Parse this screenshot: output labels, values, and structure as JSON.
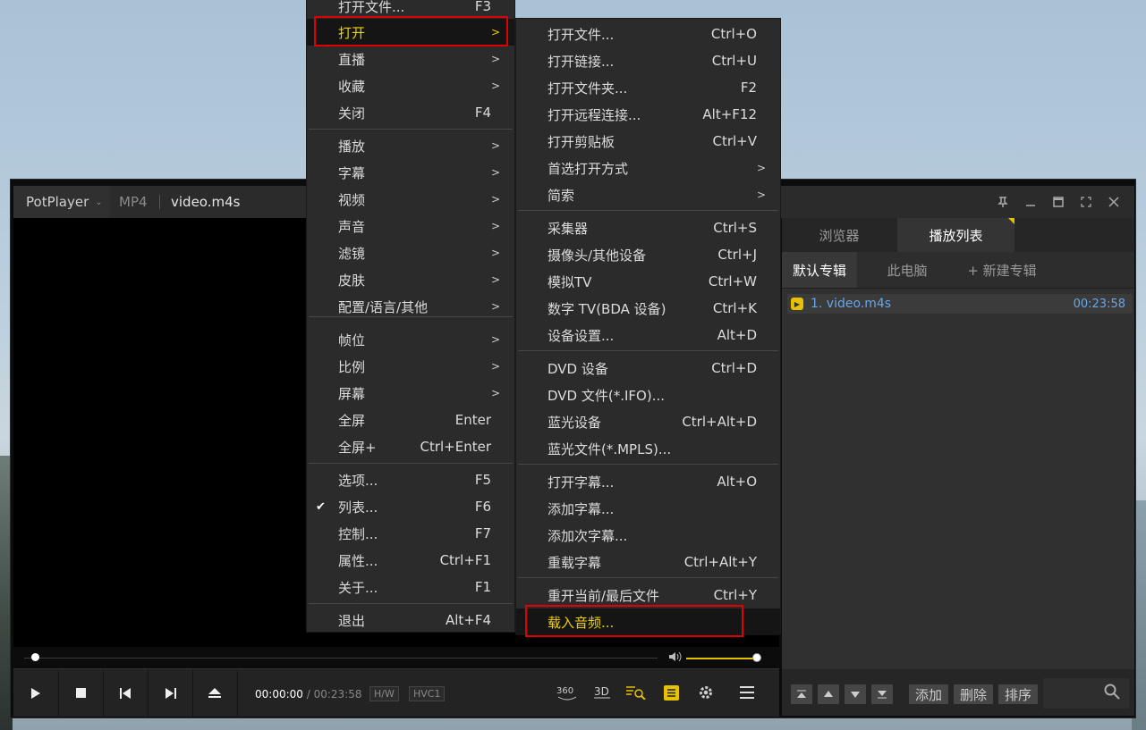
{
  "player": {
    "brand": "PotPlayer",
    "format": "MP4",
    "filename": "video.m4s",
    "time_current": "00:00:00",
    "time_separator": "/",
    "time_total": "00:23:58",
    "tag_hw": "H/W",
    "tag_codec": "HVC1",
    "seek_progress": 0,
    "volume_level": 0.95
  },
  "panel": {
    "tabs": [
      "浏览器",
      "播放列表"
    ],
    "active_tab": "播放列表",
    "subtabs": [
      "默认专辑",
      "此电脑",
      "+ 新建专辑"
    ],
    "playlist": [
      {
        "title": "1. video.m4s",
        "duration": "00:23:58"
      }
    ],
    "footer_buttons": [
      "添加",
      "删除",
      "排序"
    ]
  },
  "main_menu": {
    "items": [
      {
        "label": "打开文件...",
        "shortcut": "F3"
      },
      {
        "label": "打开",
        "submenu": ">",
        "highlighted": true
      },
      {
        "label": "直播",
        "submenu": ">"
      },
      {
        "label": "收藏",
        "submenu": ">"
      },
      {
        "label": "关闭",
        "shortcut": "F4"
      },
      {
        "label": "播放",
        "submenu": ">"
      },
      {
        "label": "字幕",
        "submenu": ">"
      },
      {
        "label": "视频",
        "submenu": ">"
      },
      {
        "label": "声音",
        "submenu": ">"
      },
      {
        "label": "滤镜",
        "submenu": ">"
      },
      {
        "label": "皮肤",
        "submenu": ">"
      },
      {
        "label": "配置/语言/其他",
        "submenu": ">"
      },
      {
        "label": "帧位",
        "submenu": ">"
      },
      {
        "label": "比例",
        "submenu": ">"
      },
      {
        "label": "屏幕",
        "submenu": ">"
      },
      {
        "label": "全屏",
        "shortcut": "Enter"
      },
      {
        "label": "全屏+",
        "shortcut": "Ctrl+Enter"
      },
      {
        "label": "选项...",
        "shortcut": "F5"
      },
      {
        "label": "列表...",
        "shortcut": "F6",
        "checked": true
      },
      {
        "label": "控制...",
        "shortcut": "F7"
      },
      {
        "label": "属性...",
        "shortcut": "Ctrl+F1"
      },
      {
        "label": "关于...",
        "shortcut": "F1"
      },
      {
        "label": "退出",
        "shortcut": "Alt+F4"
      }
    ]
  },
  "open_submenu": {
    "items": [
      {
        "label": "打开文件...",
        "shortcut": "Ctrl+O"
      },
      {
        "label": "打开链接...",
        "shortcut": "Ctrl+U"
      },
      {
        "label": "打开文件夹...",
        "shortcut": "F2"
      },
      {
        "label": "打开远程连接...",
        "shortcut": "Alt+F12"
      },
      {
        "label": "打开剪贴板",
        "shortcut": "Ctrl+V"
      },
      {
        "label": "首选打开方式",
        "submenu": ">"
      },
      {
        "label": "简索",
        "submenu": ">"
      },
      {
        "label": "采集器",
        "shortcut": "Ctrl+S"
      },
      {
        "label": "摄像头/其他设备",
        "shortcut": "Ctrl+J"
      },
      {
        "label": "模拟TV",
        "shortcut": "Ctrl+W"
      },
      {
        "label": "数字 TV(BDA 设备)",
        "shortcut": "Ctrl+K"
      },
      {
        "label": "设备设置...",
        "shortcut": "Alt+D"
      },
      {
        "label": "DVD 设备",
        "shortcut": "Ctrl+D"
      },
      {
        "label": "DVD 文件(*.IFO)..."
      },
      {
        "label": "蓝光设备",
        "shortcut": "Ctrl+Alt+D"
      },
      {
        "label": "蓝光文件(*.MPLS)..."
      },
      {
        "label": "打开字幕...",
        "shortcut": "Alt+O"
      },
      {
        "label": "添加字幕..."
      },
      {
        "label": "添加次字幕..."
      },
      {
        "label": "重载字幕",
        "shortcut": "Ctrl+Alt+Y"
      },
      {
        "label": "重开当前/最后文件",
        "shortcut": "Ctrl+Y"
      },
      {
        "label": "载入音频...",
        "highlighted": true
      }
    ]
  },
  "colors": {
    "highlight_text": "#f0d000",
    "annotation_box": "#e00000",
    "playlist_text": "#69a6e6"
  }
}
